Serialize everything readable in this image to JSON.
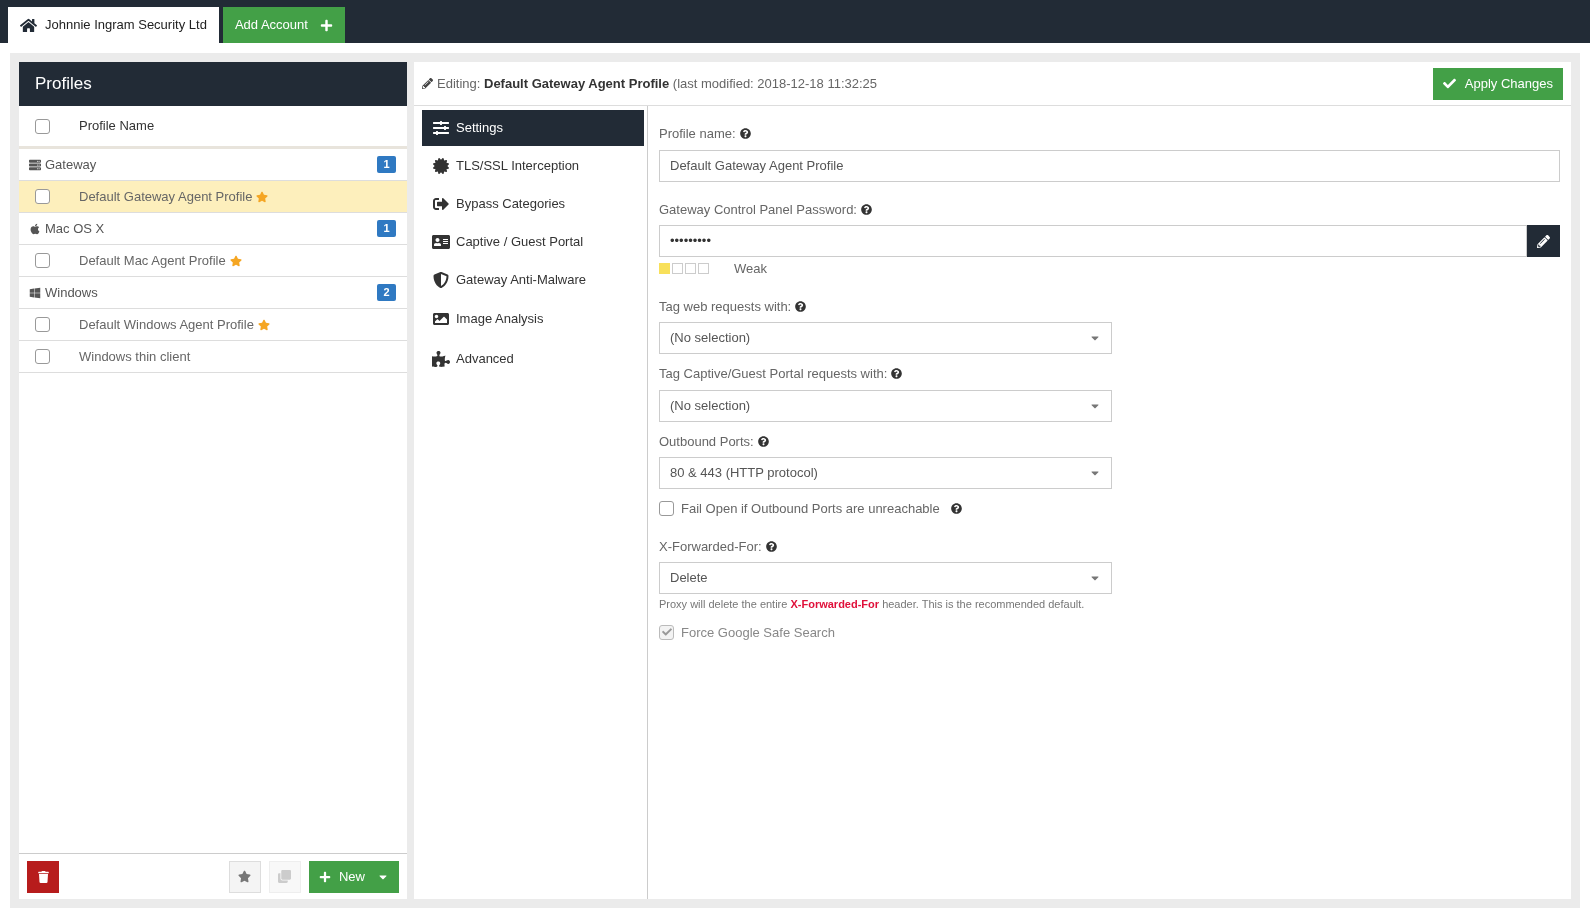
{
  "tabs": [
    {
      "label": "Johnnie Ingram Security Ltd",
      "kind": "home",
      "selected": true
    },
    {
      "label": "Add Account",
      "kind": "add",
      "selected": false
    }
  ],
  "profiles": {
    "title": "Profiles",
    "header_label": "Profile Name",
    "header_checked": false,
    "groups": [
      {
        "name": "Gateway",
        "kind": "gateway",
        "count": "1",
        "items": [
          {
            "name": "Default Gateway Agent Profile",
            "starred": true,
            "checked": false,
            "selected": true
          }
        ]
      },
      {
        "name": "Mac OS X",
        "kind": "mac",
        "count": "1",
        "items": [
          {
            "name": "Default Mac Agent Profile",
            "starred": true,
            "checked": false,
            "selected": false
          }
        ]
      },
      {
        "name": "Windows",
        "kind": "windows",
        "count": "2",
        "items": [
          {
            "name": "Default Windows Agent Profile",
            "starred": true,
            "checked": false,
            "selected": false
          },
          {
            "name": "Windows thin client",
            "starred": false,
            "checked": false,
            "selected": false
          }
        ]
      }
    ],
    "new_label": "New"
  },
  "editor": {
    "prefix": "Editing:",
    "profile": "Default Gateway Agent Profile",
    "modified": "(last modified: 2018-12-18 11:32:25",
    "apply_label": "Apply Changes"
  },
  "nav": [
    {
      "label": "Settings",
      "kind": "settings",
      "selected": true
    },
    {
      "label": "TLS/SSL Interception",
      "kind": "tls",
      "selected": false
    },
    {
      "label": "Bypass Categories",
      "kind": "bypass",
      "selected": false
    },
    {
      "label": "Captive / Guest Portal",
      "kind": "portal",
      "selected": false
    },
    {
      "label": "Gateway Anti-Malware",
      "kind": "malware",
      "selected": false
    },
    {
      "label": "Image Analysis",
      "kind": "image",
      "selected": false
    },
    {
      "label": "Advanced",
      "kind": "advanced",
      "selected": false
    }
  ],
  "fields": [
    {
      "kind": "text",
      "label": "Profile name:",
      "value": "Default Gateway Agent Profile"
    },
    {
      "kind": "password",
      "label": "Gateway Control Panel Password:",
      "value": "•••••••••",
      "strength": {
        "level": 0.25,
        "label": "Weak"
      }
    },
    {
      "kind": "select",
      "label": "Tag web requests with:",
      "value": "(No selection)"
    },
    {
      "kind": "select",
      "label": "Tag Captive/Guest Portal requests with:",
      "value": "(No selection)"
    },
    {
      "kind": "select",
      "label": "Outbound Ports:",
      "value": "80 & 443 (HTTP protocol)"
    },
    {
      "kind": "checkbox",
      "label": "Fail Open if Outbound Ports are unreachable",
      "checked": false,
      "disabled": false,
      "help": true
    },
    {
      "kind": "select",
      "label": "X-Forwarded-For:",
      "value": "Delete",
      "note": "Proxy will delete the entire **X-Forwarded-For** header. This is the recommended default."
    },
    {
      "kind": "checkbox",
      "label": "Force Google Safe Search",
      "checked": true,
      "disabled": true,
      "help": false
    }
  ]
}
